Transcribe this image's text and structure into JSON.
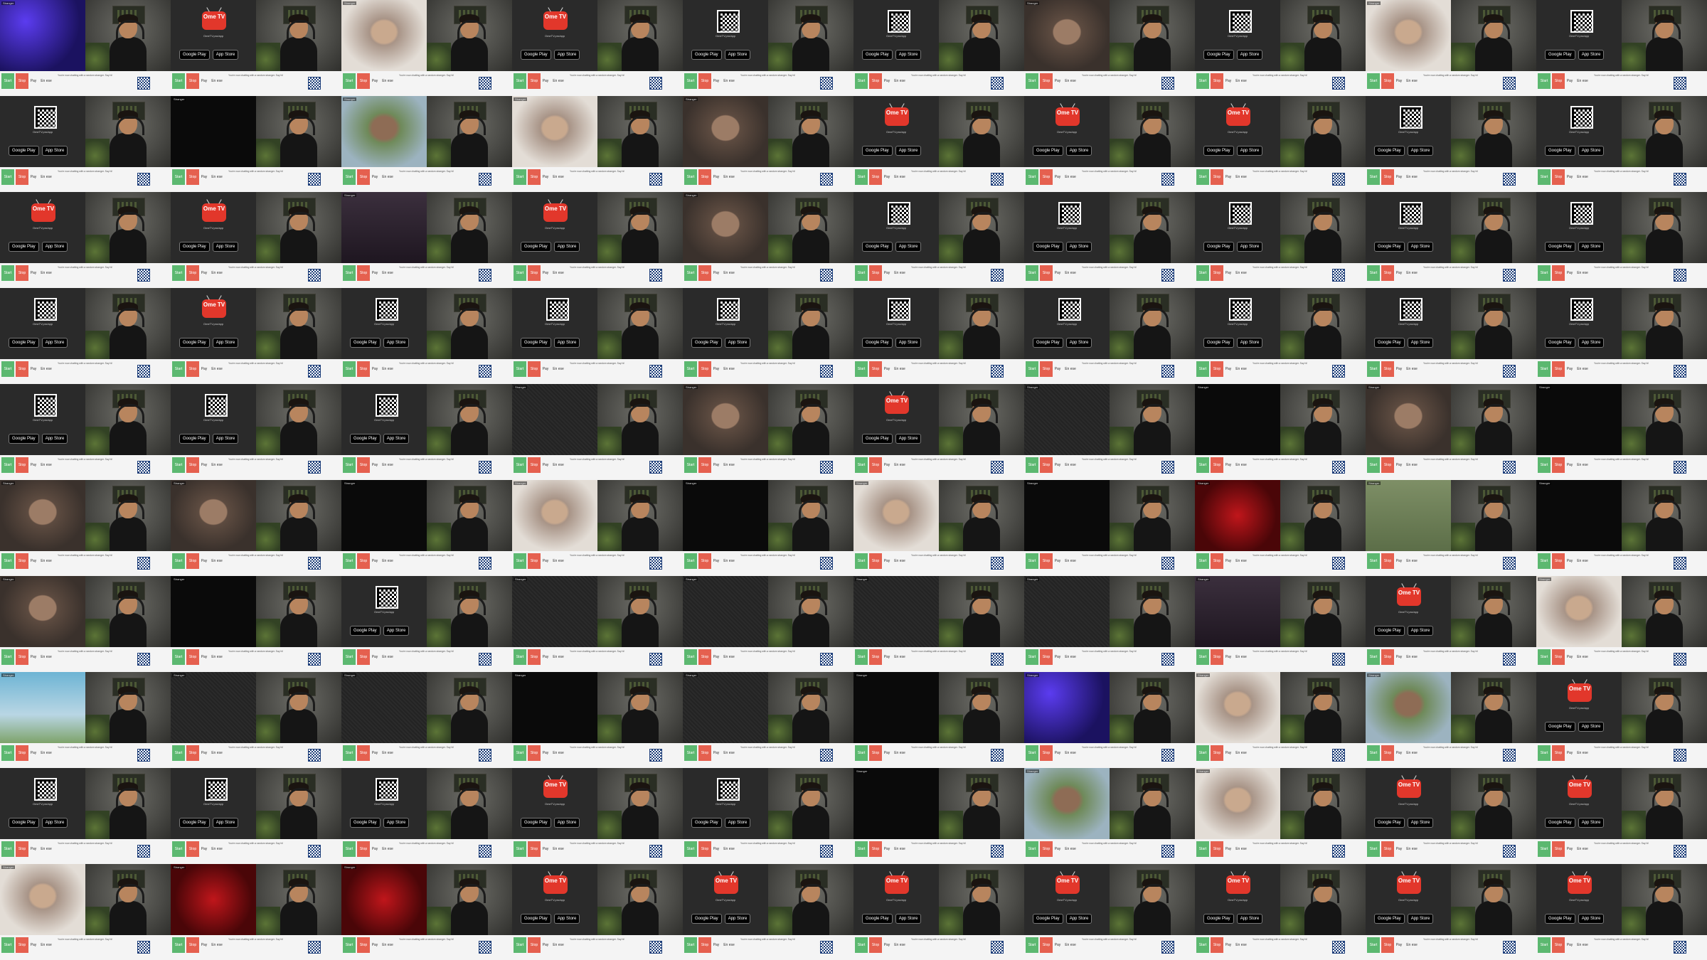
{
  "omegle": {
    "logo_text": "Ome TV",
    "subtitle": "OmeTV.pro/app",
    "google_play": "Google Play",
    "app_store": "App Store"
  },
  "controls": {
    "start": "Start",
    "stop": "Stop",
    "pay": "Pay",
    "language": "En ese"
  },
  "stranger_tag": "Stranger",
  "chat_placeholder": "You're now chatting with a random stranger. Say hi!",
  "colors": {
    "start": "#5cb870",
    "stop": "#e5604f",
    "brand": "#e2372b"
  },
  "tiles": [
    "purple",
    "omtv-logo",
    "light",
    "omtv-logo",
    "omtv-qr",
    "omtv-qr",
    "face",
    "omtv-qr",
    "light",
    "omtv-qr",
    "omtv-qr",
    "dark",
    "outdoor",
    "light",
    "face",
    "omtv-logo",
    "omtv-logo",
    "omtv-logo",
    "omtv-qr",
    "omtv-qr",
    "omtv-logo",
    "omtv-logo",
    "desk",
    "omtv-logo",
    "face",
    "omtv-qr",
    "omtv-qr",
    "omtv-qr",
    "omtv-qr",
    "omtv-qr",
    "omtv-qr",
    "omtv-logo",
    "omtv-qr",
    "omtv-qr",
    "omtv-qr",
    "omtv-qr",
    "omtv-qr",
    "omtv-qr",
    "omtv-qr",
    "omtv-qr",
    "omtv-qr",
    "omtv-qr",
    "omtv-qr",
    "static",
    "face",
    "omtv-logo",
    "static",
    "dark",
    "face",
    "dark",
    "face",
    "face",
    "dark",
    "light",
    "dark",
    "light",
    "dark",
    "red",
    "green",
    "dark",
    "face",
    "dark",
    "omtv-qr",
    "static",
    "static",
    "static",
    "static",
    "desk",
    "omtv-logo",
    "light",
    "sky",
    "static",
    "static",
    "dark",
    "static",
    "dark",
    "purple",
    "light",
    "outdoor",
    "omtv-logo",
    "omtv-qr",
    "omtv-qr",
    "omtv-qr",
    "omtv-logo",
    "omtv-qr",
    "dark",
    "outdoor",
    "light",
    "omtv-logo",
    "omtv-logo",
    "light",
    "red",
    "red",
    "omtv-logo",
    "omtv-logo",
    "omtv-logo",
    "omtv-logo",
    "omtv-logo",
    "omtv-logo",
    "omtv-logo"
  ]
}
